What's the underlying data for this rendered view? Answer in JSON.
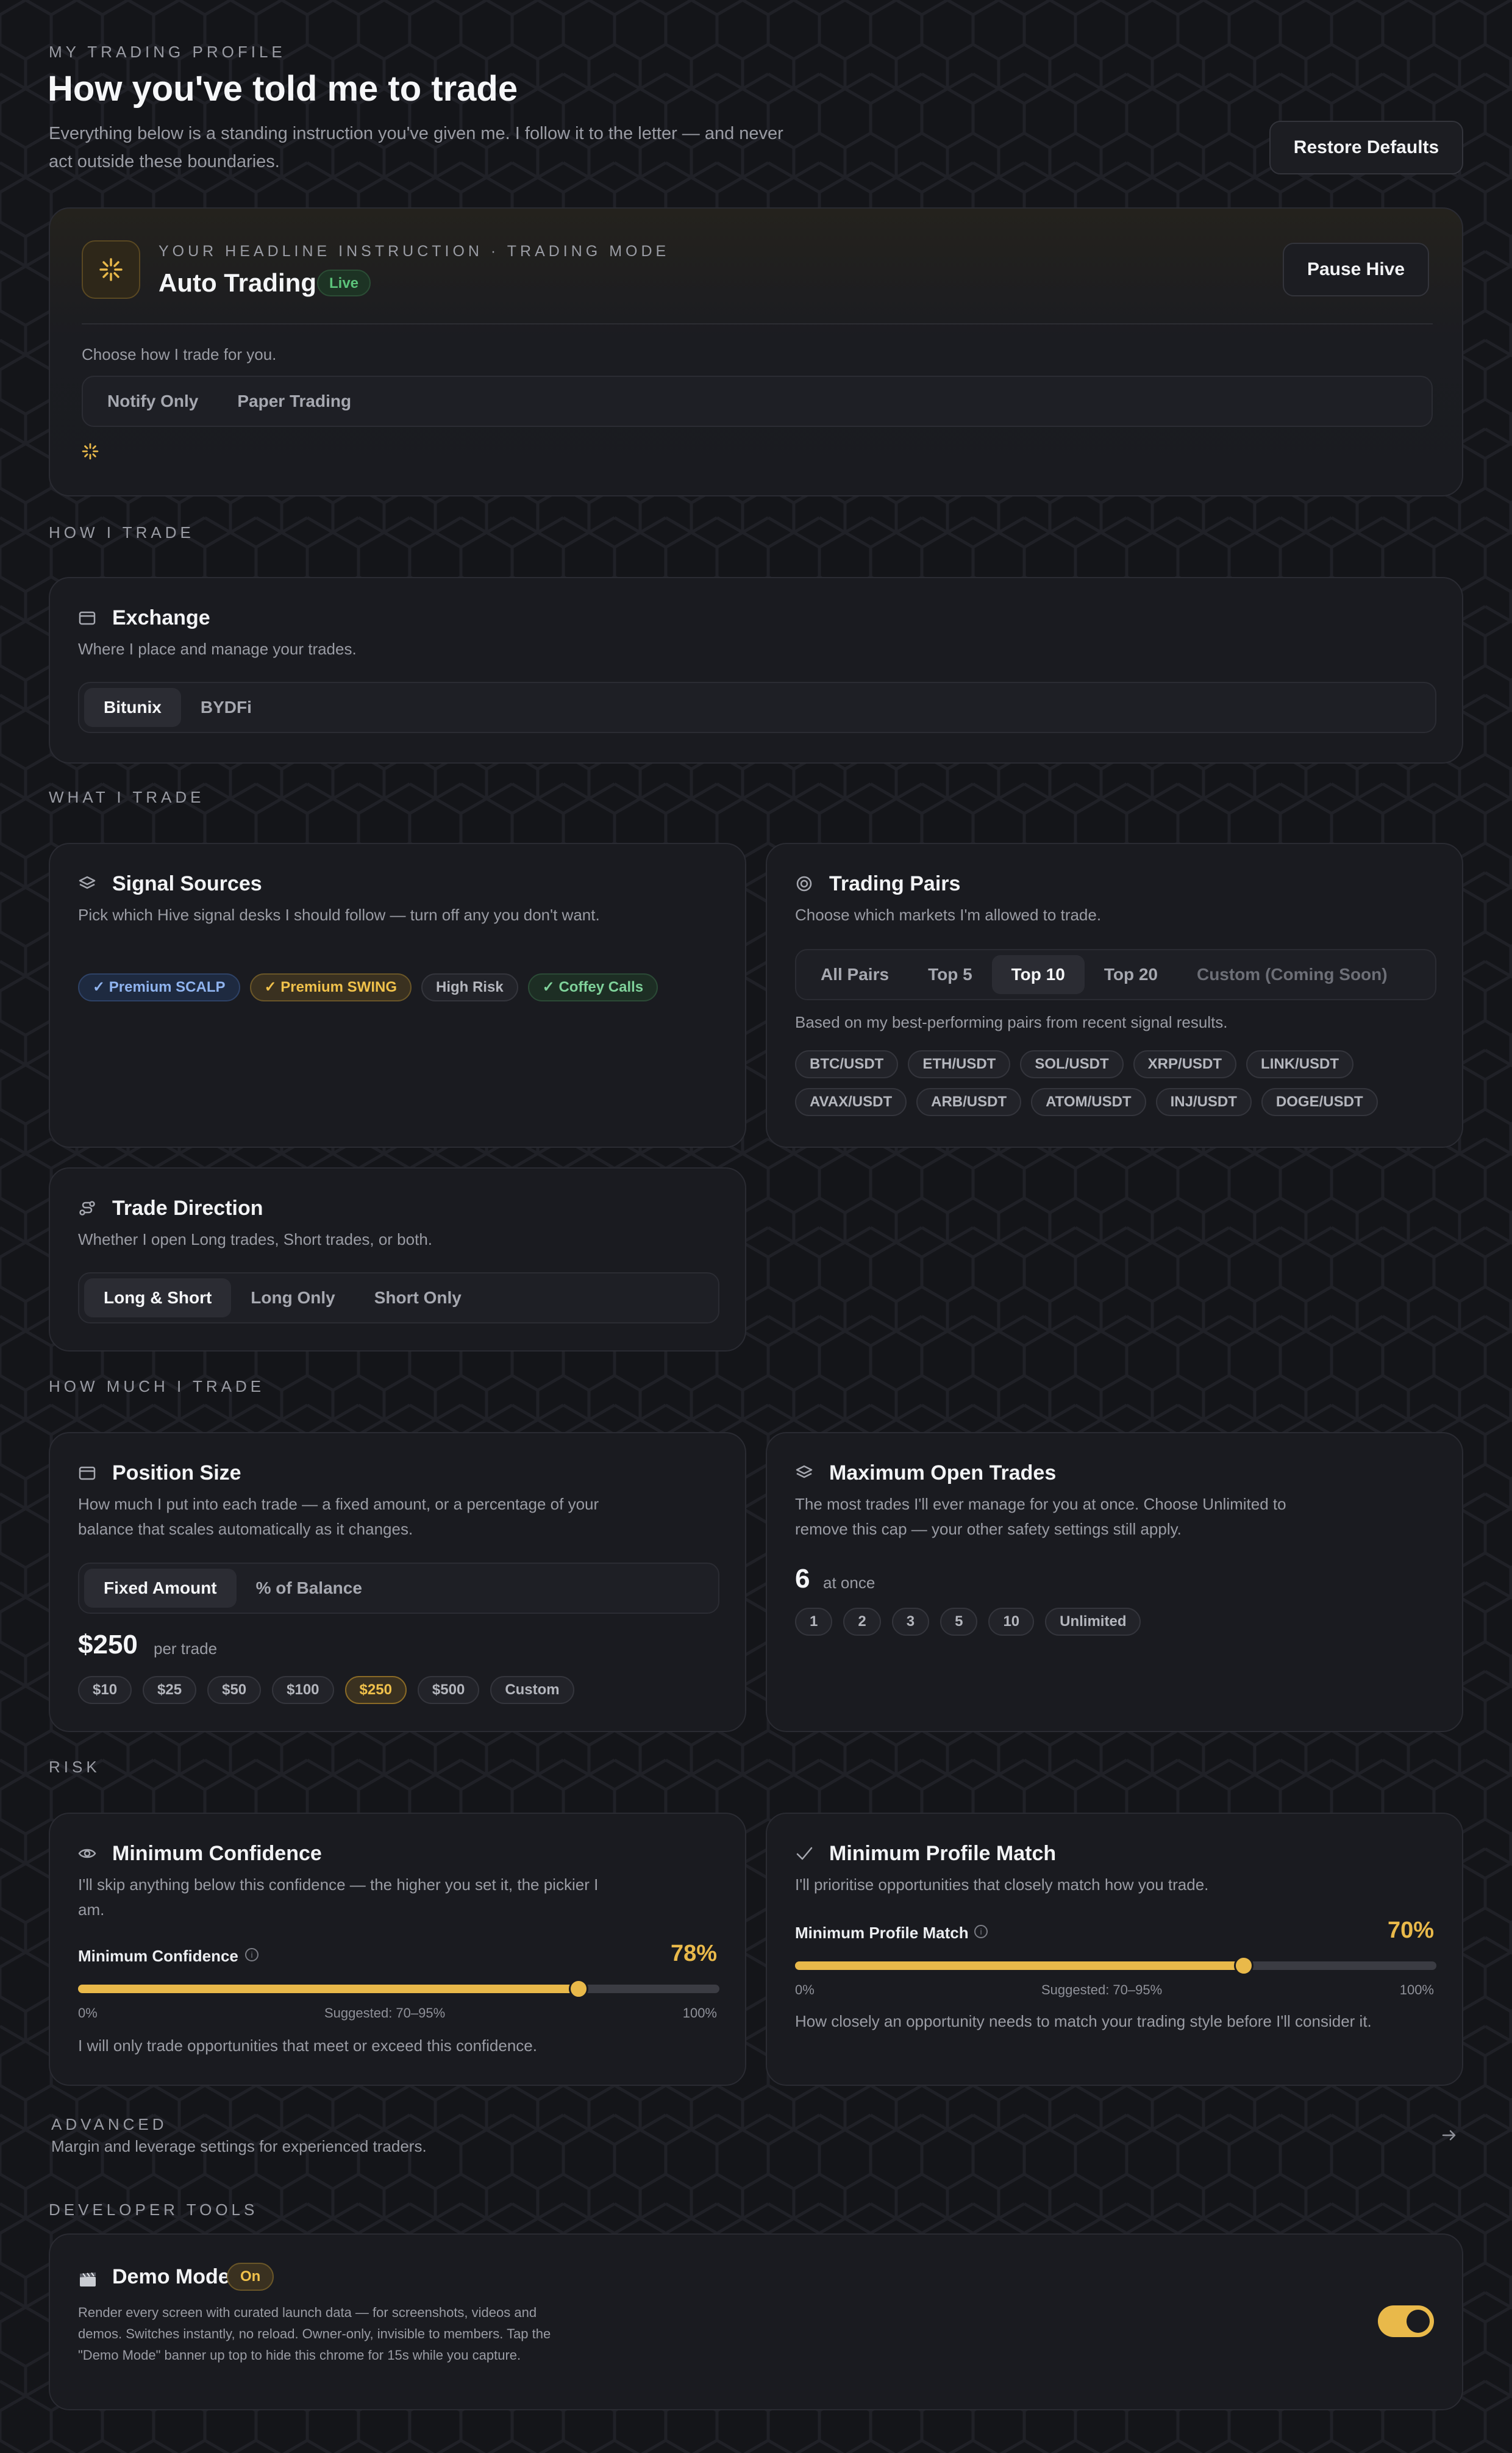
{
  "header": {
    "eyebrow": "MY TRADING PROFILE",
    "title": "How you've told me to trade",
    "subtitle": "Everything below is a standing instruction you've given me. I follow it to the letter — and never act outside these boundaries.",
    "restore_label": "Restore Defaults"
  },
  "headline": {
    "eyebrow": "YOUR HEADLINE INSTRUCTION · TRADING MODE",
    "mode": "Auto Trading",
    "badge": "Live",
    "pause_label": "Pause Hive",
    "choose_text": "Choose how I trade for you.",
    "options": [
      "Notify Only",
      "Paper Trading"
    ]
  },
  "sections": {
    "how": "HOW I TRADE",
    "what": "WHAT I TRADE",
    "how_much": "HOW MUCH I TRADE",
    "risk": "RISK",
    "advanced": "ADVANCED",
    "advanced_desc": "Margin and leverage settings for experienced traders.",
    "developer": "DEVELOPER TOOLS"
  },
  "exchange": {
    "title": "Exchange",
    "desc": "Where I place and manage your trades.",
    "options": [
      "Bitunix",
      "BYDFi"
    ],
    "selected": "Bitunix"
  },
  "signal_sources": {
    "title": "Signal Sources",
    "desc": "Pick which Hive signal desks I should follow — turn off any you don't want.",
    "chips": [
      {
        "label": "Premium SCALP",
        "checked": true,
        "color": "blue"
      },
      {
        "label": "Premium SWING",
        "checked": true,
        "color": "gold"
      },
      {
        "label": "High Risk",
        "checked": false,
        "color": "neutral"
      },
      {
        "label": "Coffey Calls",
        "checked": true,
        "color": "green"
      }
    ]
  },
  "trading_pairs": {
    "title": "Trading Pairs",
    "desc": "Choose which markets I'm allowed to trade.",
    "options": [
      "All Pairs",
      "Top 5",
      "Top 10",
      "Top 20",
      "Custom (Coming Soon)"
    ],
    "selected": "Top 10",
    "note": "Based on my best-performing pairs from recent signal results.",
    "pairs": [
      "BTC/USDT",
      "ETH/USDT",
      "SOL/USDT",
      "XRP/USDT",
      "LINK/USDT",
      "AVAX/USDT",
      "ARB/USDT",
      "ATOM/USDT",
      "INJ/USDT",
      "DOGE/USDT"
    ]
  },
  "trade_direction": {
    "title": "Trade Direction",
    "desc": "Whether I open Long trades, Short trades, or both.",
    "options": [
      "Long & Short",
      "Long Only",
      "Short Only"
    ],
    "selected": "Long & Short"
  },
  "position_size": {
    "title": "Position Size",
    "desc": "How much I put into each trade — a fixed amount, or a percentage of your balance that scales automatically as it changes.",
    "options": [
      "Fixed Amount",
      "% of Balance"
    ],
    "selected": "Fixed Amount",
    "value": "$250",
    "unit": "per trade",
    "presets": [
      "$10",
      "$25",
      "$50",
      "$100",
      "$250",
      "$500",
      "Custom"
    ],
    "selected_preset": "$250"
  },
  "max_open_trades": {
    "title": "Maximum Open Trades",
    "desc": "The most trades I'll ever manage for you at once. Choose Unlimited to remove this cap — your other safety settings still apply.",
    "value": "6",
    "unit": "at once",
    "presets": [
      "1",
      "2",
      "3",
      "5",
      "10",
      "Unlimited"
    ]
  },
  "min_confidence": {
    "title": "Minimum Confidence",
    "desc": "I'll skip anything below this confidence — the higher you set it, the pickier I am.",
    "label": "Minimum Confidence",
    "value_text": "78%",
    "value": 78,
    "min_label": "0%",
    "suggested": "Suggested: 70–95%",
    "max_label": "100%",
    "footer": "I will only trade opportunities that meet or exceed this confidence."
  },
  "min_profile_match": {
    "title": "Minimum Profile Match",
    "desc": "I'll prioritise opportunities that closely match how you trade.",
    "label": "Minimum Profile Match",
    "value_text": "70%",
    "value": 70,
    "min_label": "0%",
    "suggested": "Suggested: 70–95%",
    "max_label": "100%",
    "footer": "How closely an opportunity needs to match your trading style before I'll consider it."
  },
  "demo_mode": {
    "title": "Demo Mode",
    "badge": "On",
    "desc": "Render every screen with curated launch data — for screenshots, videos and demos. Switches instantly, no reload. Owner-only, invisible to members. Tap the \"Demo Mode\" banner up top to hide this chrome for 15s while you capture.",
    "enabled": true
  },
  "colors": {
    "accent": "#e9b94a",
    "background": "#141519",
    "card": "#1a1b20",
    "live_green": "#5cc37a"
  }
}
